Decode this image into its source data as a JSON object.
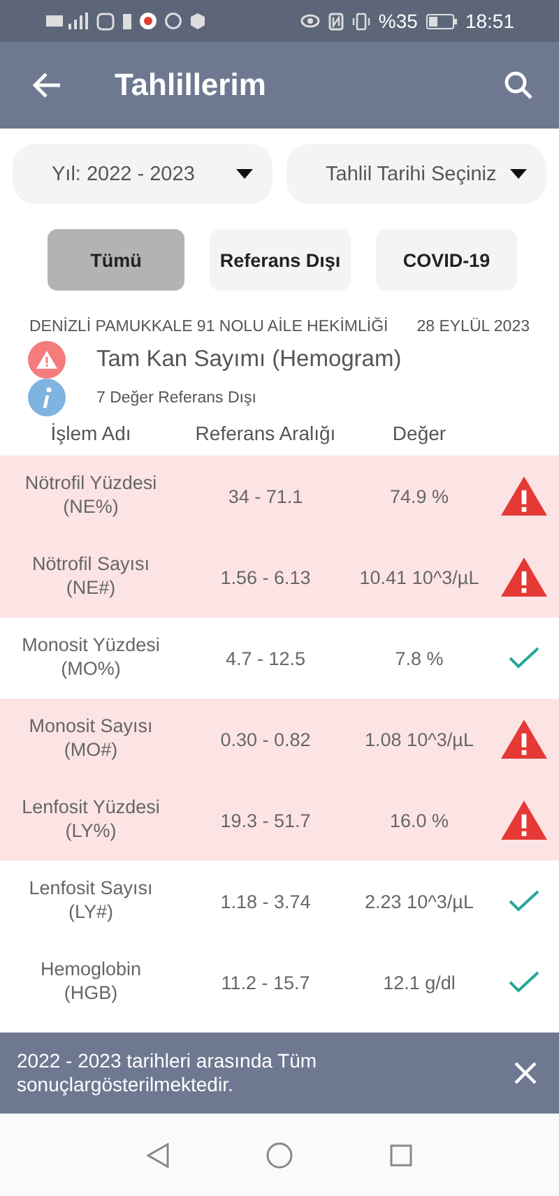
{
  "status_bar": {
    "battery_text": "%35",
    "time": "18:51"
  },
  "app_bar": {
    "title": "Tahlillerim"
  },
  "dropdowns": [
    {
      "label": "Yıl: 2022 - 2023"
    },
    {
      "label": "Tahlil Tarihi Seçiniz"
    }
  ],
  "filters": [
    {
      "label": "Tümü",
      "selected": true
    },
    {
      "label": "Referans Dışı",
      "selected": false
    },
    {
      "label": "COVID-19",
      "selected": false
    }
  ],
  "report": {
    "clinic": "DENİZLİ PAMUKKALE 91 NOLU AİLE HEKİMLİĞİ",
    "date": "28 EYLÜL 2023",
    "test_name": "Tam Kan Sayımı (Hemogram)",
    "summary": "7 Değer Referans Dışı"
  },
  "table": {
    "columns": [
      "İşlem Adı",
      "Referans Aralığı",
      "Değer"
    ],
    "rows": [
      {
        "name": "Nötrofil Yüzdesi",
        "code": "(NE%)",
        "range": "34 - 71.1",
        "value": "74.9 %",
        "kind": "out"
      },
      {
        "name": "Nötrofil Sayısı",
        "code": "(NE#)",
        "range": "1.56 - 6.13",
        "value": "10.41 10^3/µL",
        "kind": "out"
      },
      {
        "name": "Monosit Yüzdesi",
        "code": "(MO%)",
        "range": "4.7 - 12.5",
        "value": "7.8 %",
        "kind": "normal"
      },
      {
        "name": "Monosit Sayısı",
        "code": "(MO#)",
        "range": "0.30 - 0.82",
        "value": "1.08 10^3/µL",
        "kind": "out"
      },
      {
        "name": "Lenfosit Yüzdesi",
        "code": "(LY%)",
        "range": "19.3 - 51.7",
        "value": "16.0 %",
        "kind": "out"
      },
      {
        "name": "Lenfosit Sayısı",
        "code": "(LY#)",
        "range": "1.18 - 3.74",
        "value": "2.23 10^3/µL",
        "kind": "normal"
      },
      {
        "name": "Hemoglobin",
        "code": "(HGB)",
        "range": "11.2 - 15.7",
        "value": "12.1 g/dl",
        "kind": "normal"
      }
    ]
  },
  "snackbar": {
    "message": "2022 - 2023 tarihleri arasında Tüm sonuçlargösterilmektedir."
  }
}
